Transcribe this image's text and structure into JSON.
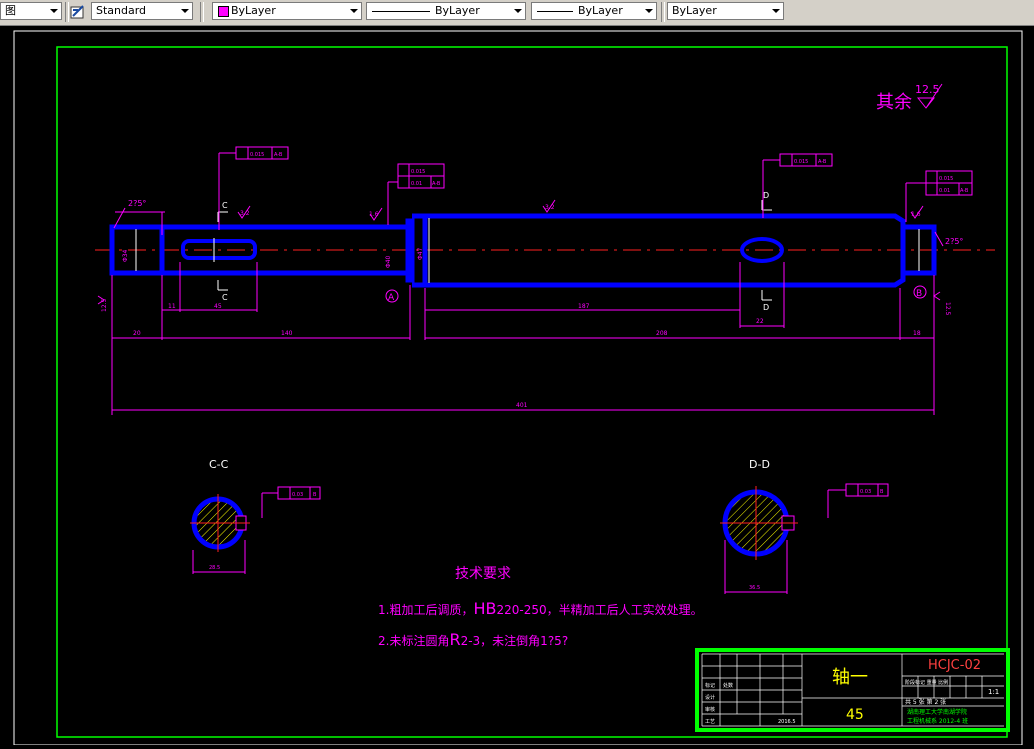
{
  "toolbar": {
    "first_combo": "图",
    "text_style": "Standard",
    "color": "ByLayer",
    "color_swatch": "#ff00ff",
    "linetype": "ByLayer",
    "lineweight": "ByLayer",
    "plot_style": "ByLayer"
  },
  "drawing": {
    "surface_finish_note": "其余",
    "surface_finish_value": "12.5",
    "section_cc": "C-C",
    "section_dd": "D-D",
    "section_c_mark": "C",
    "section_d_mark": "D",
    "datum_a": "A",
    "datum_b": "B",
    "chamfer_left": "2?5°",
    "chamfer_right": "2?5°",
    "tol_1": "0.015",
    "tol_1_ref": "A-B",
    "tol_2": "0.015",
    "tol_2_ref": "A-B",
    "tol_3a": "0.015",
    "tol_3b": "0.01",
    "tol_3_ref": "A-B",
    "tol_4a": "0.015",
    "tol_4b": "0.01",
    "tol_4_ref": "A-B",
    "tol_cc": "0.03",
    "tol_cc_ref": "B",
    "tol_dd": "0.03",
    "tol_dd_ref": "B",
    "rough_32": "3.2",
    "rough_16": "1.6",
    "rough_125": "12.5",
    "dim_20": "20",
    "dim_11": "11",
    "dim_45": "45",
    "dim_140": "140",
    "dim_187": "187",
    "dim_22": "22",
    "dim_208": "208",
    "dim_18": "18",
    "dim_401": "401",
    "dim_cc_width": "28.5",
    "dim_dd_width": "36.5",
    "diam_left": "Φ34",
    "diam_journal": "Φ40",
    "diam_main": "Φ47",
    "tech_title": "技术要求",
    "tech_line1_pre": "1.粗加工后调质，",
    "tech_line1_hb": "HB",
    "tech_line1_post": "220-250，半精加工后人工实效处理。",
    "tech_line2_pre": "2.未标注圆角",
    "tech_line2_r": "R",
    "tech_line2_post": "2-3，未注倒角1?5?"
  },
  "title_block": {
    "part_name": "轴一",
    "drawing_no": "HCJC-02",
    "material": "45",
    "scale": "1:1",
    "sheet_info": "共 5 张    第 2 张",
    "school_line1": "湖南理工大学南湖学院",
    "school_line2": "工程机械系 2012-4 班",
    "row_labels": [
      "标记",
      "处数",
      "设计",
      "审核",
      "工艺"
    ],
    "col_head": "阶段标记  重量  比例",
    "date": "2016.5"
  }
}
